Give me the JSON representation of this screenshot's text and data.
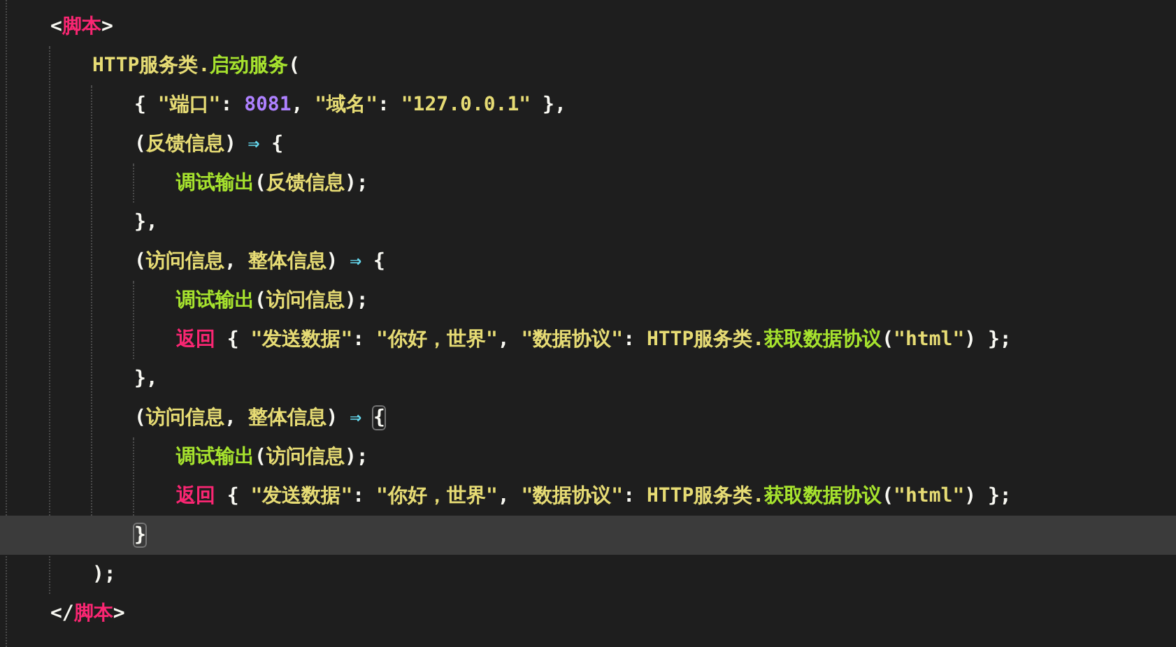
{
  "editor": {
    "lines": [
      {
        "current": false,
        "tokens": [
          {
            "text": "<",
            "kind": "punct"
          },
          {
            "text": "脚本",
            "kind": "tag"
          },
          {
            "text": ">",
            "kind": "punct"
          }
        ],
        "children": [
          {
            "current": false,
            "tokens": [
              {
                "text": "HTTP服务类.",
                "kind": "class"
              },
              {
                "text": "启动服务",
                "kind": "func"
              },
              {
                "text": "(",
                "kind": "punct"
              }
            ],
            "children": [
              {
                "current": false,
                "tokens": [
                  {
                    "text": "{ ",
                    "kind": "punct"
                  },
                  {
                    "text": "\"端口\"",
                    "kind": "string"
                  },
                  {
                    "text": ": ",
                    "kind": "punct"
                  },
                  {
                    "text": "8081",
                    "kind": "number"
                  },
                  {
                    "text": ", ",
                    "kind": "punct"
                  },
                  {
                    "text": "\"域名\"",
                    "kind": "string"
                  },
                  {
                    "text": ": ",
                    "kind": "punct"
                  },
                  {
                    "text": "\"127.0.0.1\"",
                    "kind": "string"
                  },
                  {
                    "text": " },",
                    "kind": "punct"
                  }
                ]
              },
              {
                "current": false,
                "tokens": [
                  {
                    "text": "(",
                    "kind": "punct"
                  },
                  {
                    "text": "反馈信息",
                    "kind": "param"
                  },
                  {
                    "text": ") ",
                    "kind": "punct"
                  },
                  {
                    "text": "⇒ ",
                    "kind": "arrow"
                  },
                  {
                    "text": "{",
                    "kind": "bracket",
                    "matched": false
                  }
                ],
                "children": [
                  {
                    "current": false,
                    "tokens": [
                      {
                        "text": "调试输出",
                        "kind": "func"
                      },
                      {
                        "text": "(",
                        "kind": "punct"
                      },
                      {
                        "text": "反馈信息",
                        "kind": "param"
                      },
                      {
                        "text": ");",
                        "kind": "punct"
                      }
                    ]
                  }
                ]
              },
              {
                "current": false,
                "tokens": [
                  {
                    "text": "},",
                    "kind": "punct"
                  }
                ]
              },
              {
                "current": false,
                "tokens": [
                  {
                    "text": "(",
                    "kind": "punct"
                  },
                  {
                    "text": "访问信息",
                    "kind": "param"
                  },
                  {
                    "text": ", ",
                    "kind": "punct"
                  },
                  {
                    "text": "整体信息",
                    "kind": "param"
                  },
                  {
                    "text": ") ",
                    "kind": "punct"
                  },
                  {
                    "text": "⇒ ",
                    "kind": "arrow"
                  },
                  {
                    "text": "{",
                    "kind": "bracket",
                    "matched": false
                  }
                ],
                "children": [
                  {
                    "current": false,
                    "tokens": [
                      {
                        "text": "调试输出",
                        "kind": "func"
                      },
                      {
                        "text": "(",
                        "kind": "punct"
                      },
                      {
                        "text": "访问信息",
                        "kind": "param"
                      },
                      {
                        "text": ");",
                        "kind": "punct"
                      }
                    ]
                  },
                  {
                    "current": false,
                    "tokens": [
                      {
                        "text": "返回",
                        "kind": "keyword"
                      },
                      {
                        "text": " { ",
                        "kind": "punct"
                      },
                      {
                        "text": "\"发送数据\"",
                        "kind": "string"
                      },
                      {
                        "text": ": ",
                        "kind": "punct"
                      },
                      {
                        "text": "\"你好，世界\"",
                        "kind": "string"
                      },
                      {
                        "text": ", ",
                        "kind": "punct"
                      },
                      {
                        "text": "\"数据协议\"",
                        "kind": "string"
                      },
                      {
                        "text": ": ",
                        "kind": "punct"
                      },
                      {
                        "text": "HTTP服务类.",
                        "kind": "class"
                      },
                      {
                        "text": "获取数据协议",
                        "kind": "func"
                      },
                      {
                        "text": "(",
                        "kind": "punct"
                      },
                      {
                        "text": "\"html\"",
                        "kind": "string"
                      },
                      {
                        "text": ") };",
                        "kind": "punct"
                      }
                    ]
                  }
                ]
              },
              {
                "current": false,
                "tokens": [
                  {
                    "text": "},",
                    "kind": "punct"
                  }
                ]
              },
              {
                "current": false,
                "tokens": [
                  {
                    "text": "(",
                    "kind": "punct"
                  },
                  {
                    "text": "访问信息",
                    "kind": "param"
                  },
                  {
                    "text": ", ",
                    "kind": "punct"
                  },
                  {
                    "text": "整体信息",
                    "kind": "param"
                  },
                  {
                    "text": ") ",
                    "kind": "punct"
                  },
                  {
                    "text": "⇒ ",
                    "kind": "arrow"
                  },
                  {
                    "text": "{",
                    "kind": "bracket",
                    "matched": true
                  }
                ],
                "children": [
                  {
                    "current": false,
                    "tokens": [
                      {
                        "text": "调试输出",
                        "kind": "func"
                      },
                      {
                        "text": "(",
                        "kind": "punct"
                      },
                      {
                        "text": "访问信息",
                        "kind": "param"
                      },
                      {
                        "text": ");",
                        "kind": "punct"
                      }
                    ]
                  },
                  {
                    "current": false,
                    "tokens": [
                      {
                        "text": "返回",
                        "kind": "keyword"
                      },
                      {
                        "text": " { ",
                        "kind": "punct"
                      },
                      {
                        "text": "\"发送数据\"",
                        "kind": "string"
                      },
                      {
                        "text": ": ",
                        "kind": "punct"
                      },
                      {
                        "text": "\"你好，世界\"",
                        "kind": "string"
                      },
                      {
                        "text": ", ",
                        "kind": "punct"
                      },
                      {
                        "text": "\"数据协议\"",
                        "kind": "string"
                      },
                      {
                        "text": ": ",
                        "kind": "punct"
                      },
                      {
                        "text": "HTTP服务类.",
                        "kind": "class"
                      },
                      {
                        "text": "获取数据协议",
                        "kind": "func"
                      },
                      {
                        "text": "(",
                        "kind": "punct"
                      },
                      {
                        "text": "\"html\"",
                        "kind": "string"
                      },
                      {
                        "text": ") };",
                        "kind": "punct"
                      }
                    ]
                  }
                ]
              },
              {
                "current": true,
                "tokens": [
                  {
                    "text": "}",
                    "kind": "bracket",
                    "matched": true
                  }
                ]
              }
            ]
          },
          {
            "current": false,
            "tokens": [
              {
                "text": ");",
                "kind": "punct"
              }
            ]
          }
        ]
      },
      {
        "current": false,
        "tokens": [
          {
            "text": "</",
            "kind": "punct"
          },
          {
            "text": "脚本",
            "kind": "tag"
          },
          {
            "text": ">",
            "kind": "punct"
          }
        ]
      }
    ]
  }
}
